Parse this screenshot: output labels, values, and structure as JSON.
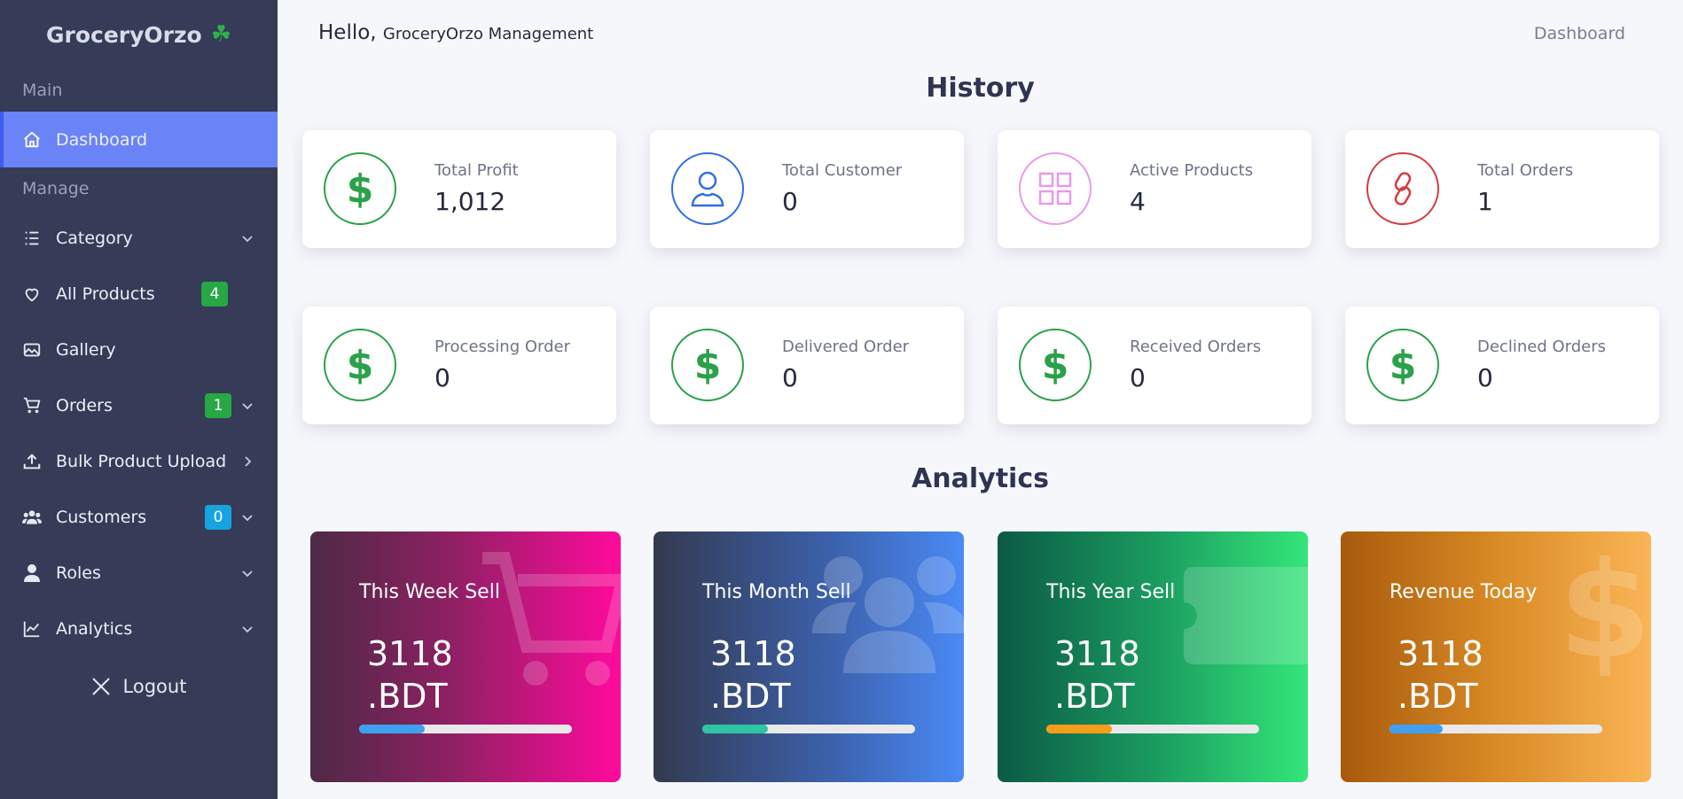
{
  "brand": {
    "name": "GroceryOrzo",
    "emoji": "☘"
  },
  "sidebar": {
    "section_main": "Main",
    "section_manage": "Manage",
    "items": [
      {
        "label": "Dashboard"
      },
      {
        "label": "Category"
      },
      {
        "label": "All Products",
        "badge": "4"
      },
      {
        "label": "Gallery"
      },
      {
        "label": "Orders",
        "badge": "1"
      },
      {
        "label": "Bulk Product Upload"
      },
      {
        "label": "Customers",
        "badge": "0"
      },
      {
        "label": "Roles"
      },
      {
        "label": "Analytics"
      }
    ],
    "logout": "Logout"
  },
  "header": {
    "greeting": "Hello,",
    "org": "GroceryOrzo Management",
    "breadcrumb": "Dashboard"
  },
  "history": {
    "title": "History",
    "cards": [
      {
        "label": "Total Profit",
        "value": "1,012",
        "icon": "dollar-icon"
      },
      {
        "label": "Total Customer",
        "value": "0",
        "icon": "user-icon"
      },
      {
        "label": "Active Products",
        "value": "4",
        "icon": "grid-icon"
      },
      {
        "label": "Total Orders",
        "value": "1",
        "icon": "link-icon"
      },
      {
        "label": "Processing Order",
        "value": "0",
        "icon": "dollar-icon"
      },
      {
        "label": "Delivered Order",
        "value": "0",
        "icon": "dollar-icon"
      },
      {
        "label": "Received Orders",
        "value": "0",
        "icon": "dollar-icon"
      },
      {
        "label": "Declined Orders",
        "value": "0",
        "icon": "dollar-icon"
      }
    ]
  },
  "analytics": {
    "title": "Analytics",
    "cards": [
      {
        "label": "This Week Sell",
        "amount": "3118",
        "unit": ".BDT",
        "progress": 0.31,
        "icon": "cart-icon"
      },
      {
        "label": "This Month Sell",
        "amount": "3118",
        "unit": ".BDT",
        "progress": 0.31,
        "icon": "users-icon"
      },
      {
        "label": "This Year Sell",
        "amount": "3118",
        "unit": ".BDT",
        "progress": 0.31,
        "icon": "ticket-icon"
      },
      {
        "label": "Revenue Today",
        "amount": "3118",
        "unit": ".BDT",
        "progress": 0.25,
        "icon": "dollar-icon"
      }
    ]
  },
  "colors": {
    "sidebar": "#363b58",
    "active": "#6a83f7",
    "green": "#2aa14a",
    "blue": "#2f6ee8",
    "pink": "#e59be8",
    "red": "#d63b42"
  }
}
